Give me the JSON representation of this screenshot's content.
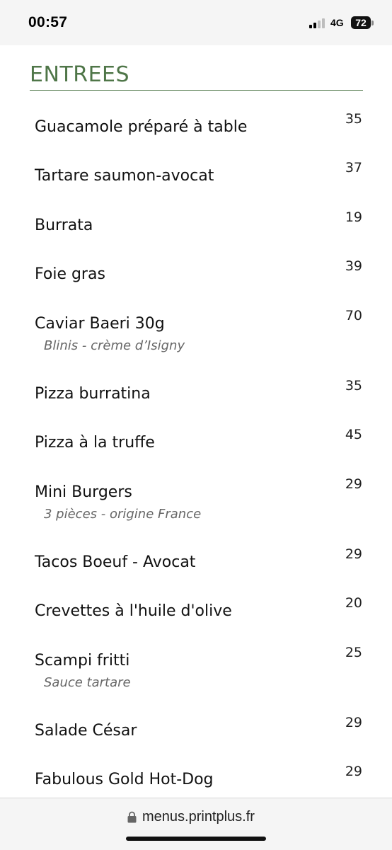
{
  "status_bar": {
    "time": "00:57",
    "network": "4G",
    "battery": "72"
  },
  "section": {
    "title": "ENTREES"
  },
  "items": [
    {
      "name": "Guacamole préparé à table",
      "price": "35",
      "desc": ""
    },
    {
      "name": "Tartare saumon-avocat",
      "price": "37",
      "desc": ""
    },
    {
      "name": "Burrata",
      "price": "19",
      "desc": ""
    },
    {
      "name": "Foie gras",
      "price": "39",
      "desc": ""
    },
    {
      "name": "Caviar Baeri 30g",
      "price": "70",
      "desc": "Blinis - crème d’Isigny"
    },
    {
      "name": "Pizza burratina",
      "price": "35",
      "desc": ""
    },
    {
      "name": "Pizza à la truffe",
      "price": "45",
      "desc": ""
    },
    {
      "name": "Mini Burgers",
      "price": "29",
      "desc": "3 pièces - origine France"
    },
    {
      "name": "Tacos Boeuf - Avocat",
      "price": "29",
      "desc": ""
    },
    {
      "name": "Crevettes à l'huile d'olive",
      "price": "20",
      "desc": ""
    },
    {
      "name": "Scampi fritti",
      "price": "25",
      "desc": "Sauce tartare"
    },
    {
      "name": "Salade César",
      "price": "29",
      "desc": ""
    },
    {
      "name": "Fabulous Gold Hot-Dog",
      "price": "29",
      "desc": ""
    }
  ],
  "browser": {
    "url": "menus.printplus.fr"
  },
  "colors": {
    "accent": "#4f7648"
  }
}
